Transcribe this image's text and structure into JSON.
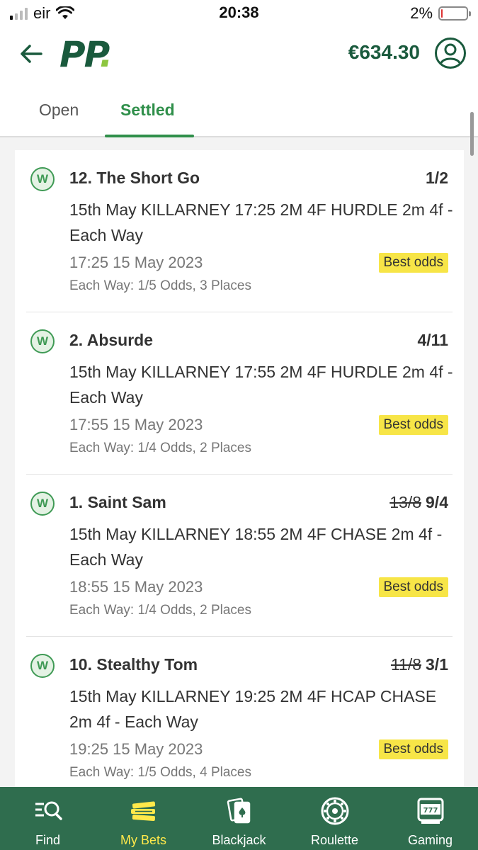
{
  "status_bar": {
    "carrier": "eir",
    "time": "20:38",
    "battery": "2%"
  },
  "header": {
    "logo_text": "PP",
    "logo_dot": ".",
    "balance": "€634.30"
  },
  "tabs": [
    {
      "label": "Open",
      "active": false
    },
    {
      "label": "Settled",
      "active": true
    }
  ],
  "bets": [
    {
      "status": "W",
      "selection": "12. The Short Go",
      "old_odds": "",
      "odds": "1/2",
      "description": "15th May KILLARNEY 17:25 2M 4F HURDLE 2m 4f - Each Way",
      "datetime": "17:25 15 May 2023",
      "badge": "Best odds",
      "each_way": "Each Way: 1/5 Odds, 3 Places"
    },
    {
      "status": "W",
      "selection": "2. Absurde",
      "old_odds": "",
      "odds": "4/11",
      "description": "15th May KILLARNEY 17:55 2M 4F HURDLE 2m 4f - Each Way",
      "datetime": "17:55 15 May 2023",
      "badge": "Best odds",
      "each_way": "Each Way: 1/4 Odds, 2 Places"
    },
    {
      "status": "W",
      "selection": "1. Saint Sam",
      "old_odds": "13/8",
      "odds": "9/4",
      "description": "15th May KILLARNEY 18:55 2M 4F CHASE 2m 4f - Each Way",
      "datetime": "18:55 15 May 2023",
      "badge": "Best odds",
      "each_way": "Each Way: 1/4 Odds, 2 Places"
    },
    {
      "status": "W",
      "selection": "10. Stealthy Tom",
      "old_odds": "11/8",
      "odds": "3/1",
      "description": "15th May KILLARNEY 19:25 2M 4F HCAP CHASE 2m 4f - Each Way",
      "datetime": "19:25 15 May 2023",
      "badge": "Best odds",
      "each_way": "Each Way: 1/5 Odds, 4 Places"
    }
  ],
  "bottom_nav": [
    {
      "label": "Find",
      "icon": "find-icon",
      "active": false
    },
    {
      "label": "My Bets",
      "icon": "my-bets-icon",
      "active": true
    },
    {
      "label": "Blackjack",
      "icon": "blackjack-icon",
      "active": false
    },
    {
      "label": "Roulette",
      "icon": "roulette-icon",
      "active": false
    },
    {
      "label": "Gaming",
      "icon": "gaming-icon",
      "active": false
    }
  ],
  "colors": {
    "brand_green": "#1a5a3d",
    "accent_green": "#2f8f4a",
    "nav_bg": "#2f6d4e",
    "badge_yellow": "#f7e547",
    "active_nav": "#ffe94a"
  }
}
